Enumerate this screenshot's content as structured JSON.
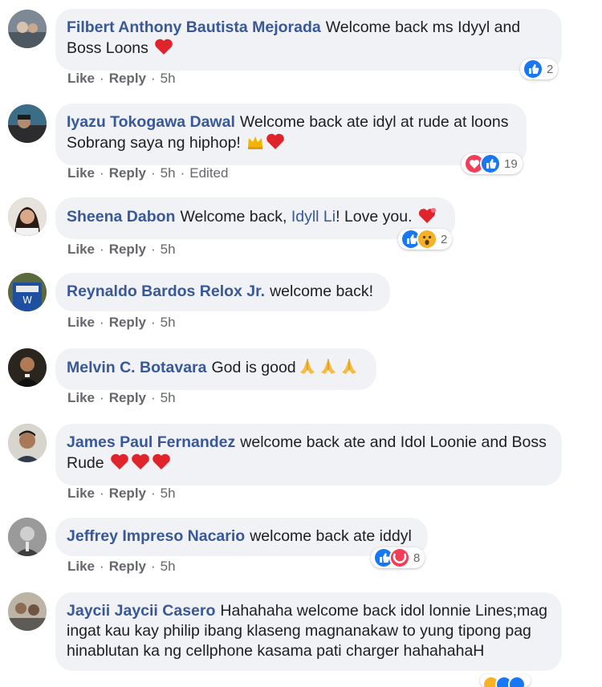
{
  "actions": {
    "like": "Like",
    "reply": "Reply",
    "separator": "·"
  },
  "comments": [
    {
      "author": "Filbert Anthony Bautista Mejorada",
      "text": "Welcome back ms Idyyl and Boss Loons",
      "emoji": [
        "heart"
      ],
      "time": "5h",
      "reactions": [
        "like"
      ],
      "reaction_count": "2"
    },
    {
      "author": "Iyazu Tokogawa Dawal",
      "text": "Welcome back ate idyl at rude at loons Sobrang saya ng hiphop!",
      "emoji": [
        "crown",
        "heart"
      ],
      "time": "5h",
      "edited": "Edited",
      "reactions": [
        "love",
        "like"
      ],
      "reaction_count": "19"
    },
    {
      "author": "Sheena Dabon",
      "text_before": "Welcome back,",
      "mention": "Idyll Li",
      "text_after": "! Love you.",
      "emoji": [
        "heart"
      ],
      "time": "5h",
      "reactions": [
        "like",
        "wow"
      ],
      "reaction_count": "2"
    },
    {
      "author": "Reynaldo Bardos Relox Jr.",
      "text": "welcome back!",
      "time": "5h"
    },
    {
      "author": "Melvin C. Botavara",
      "text": "God is good",
      "emoji": [
        "pray",
        "pray",
        "pray"
      ],
      "time": "5h"
    },
    {
      "author": "James Paul Fernandez",
      "text": "welcome back ate and Idol Loonie and Boss Rude",
      "emoji": [
        "heart",
        "heart",
        "heart"
      ],
      "time": "5h"
    },
    {
      "author": "Jeffrey Impreso Nacario",
      "text": "welcome back ate iddyl",
      "time": "5h",
      "reactions": [
        "like",
        "care"
      ],
      "reaction_count": "8"
    },
    {
      "author": "Jaycii Jaycii Casero",
      "text": "Hahahaha welcome back idol lonnie Lines;mag ingat kau kay philip ibang klaseng magnanakaw to yung tipong pag hinablutan ka ng cellphone kasama pati charger hahahahaH"
    }
  ],
  "colors": {
    "author": "#385898",
    "bubble": "#f0f2f5",
    "meta": "#65676b",
    "like": "#1877f2",
    "love": "#f33e58",
    "wow": "#f7b125"
  }
}
